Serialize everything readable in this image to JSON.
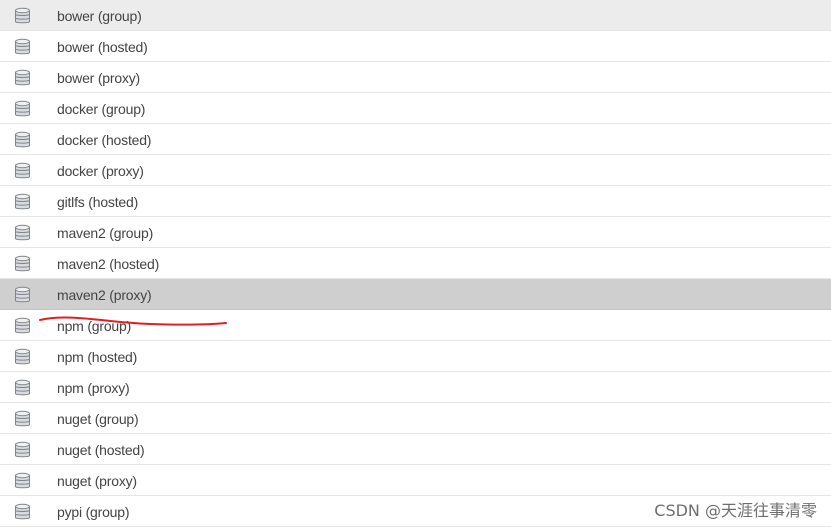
{
  "repositories": [
    {
      "name": "bower (group)"
    },
    {
      "name": "bower (hosted)"
    },
    {
      "name": "bower (proxy)"
    },
    {
      "name": "docker (group)"
    },
    {
      "name": "docker (hosted)"
    },
    {
      "name": "docker (proxy)"
    },
    {
      "name": "gitlfs (hosted)"
    },
    {
      "name": "maven2 (group)"
    },
    {
      "name": "maven2 (hosted)"
    },
    {
      "name": "maven2 (proxy)"
    },
    {
      "name": "npm (group)"
    },
    {
      "name": "npm (hosted)"
    },
    {
      "name": "npm (proxy)"
    },
    {
      "name": "nuget (group)"
    },
    {
      "name": "nuget (hosted)"
    },
    {
      "name": "nuget (proxy)"
    },
    {
      "name": "pypi (group)"
    }
  ],
  "selected_repository": "maven2 (proxy)",
  "row_icon": "database-icon",
  "annotation_color": "#e02020",
  "watermark": "CSDN @天涯往事清零"
}
